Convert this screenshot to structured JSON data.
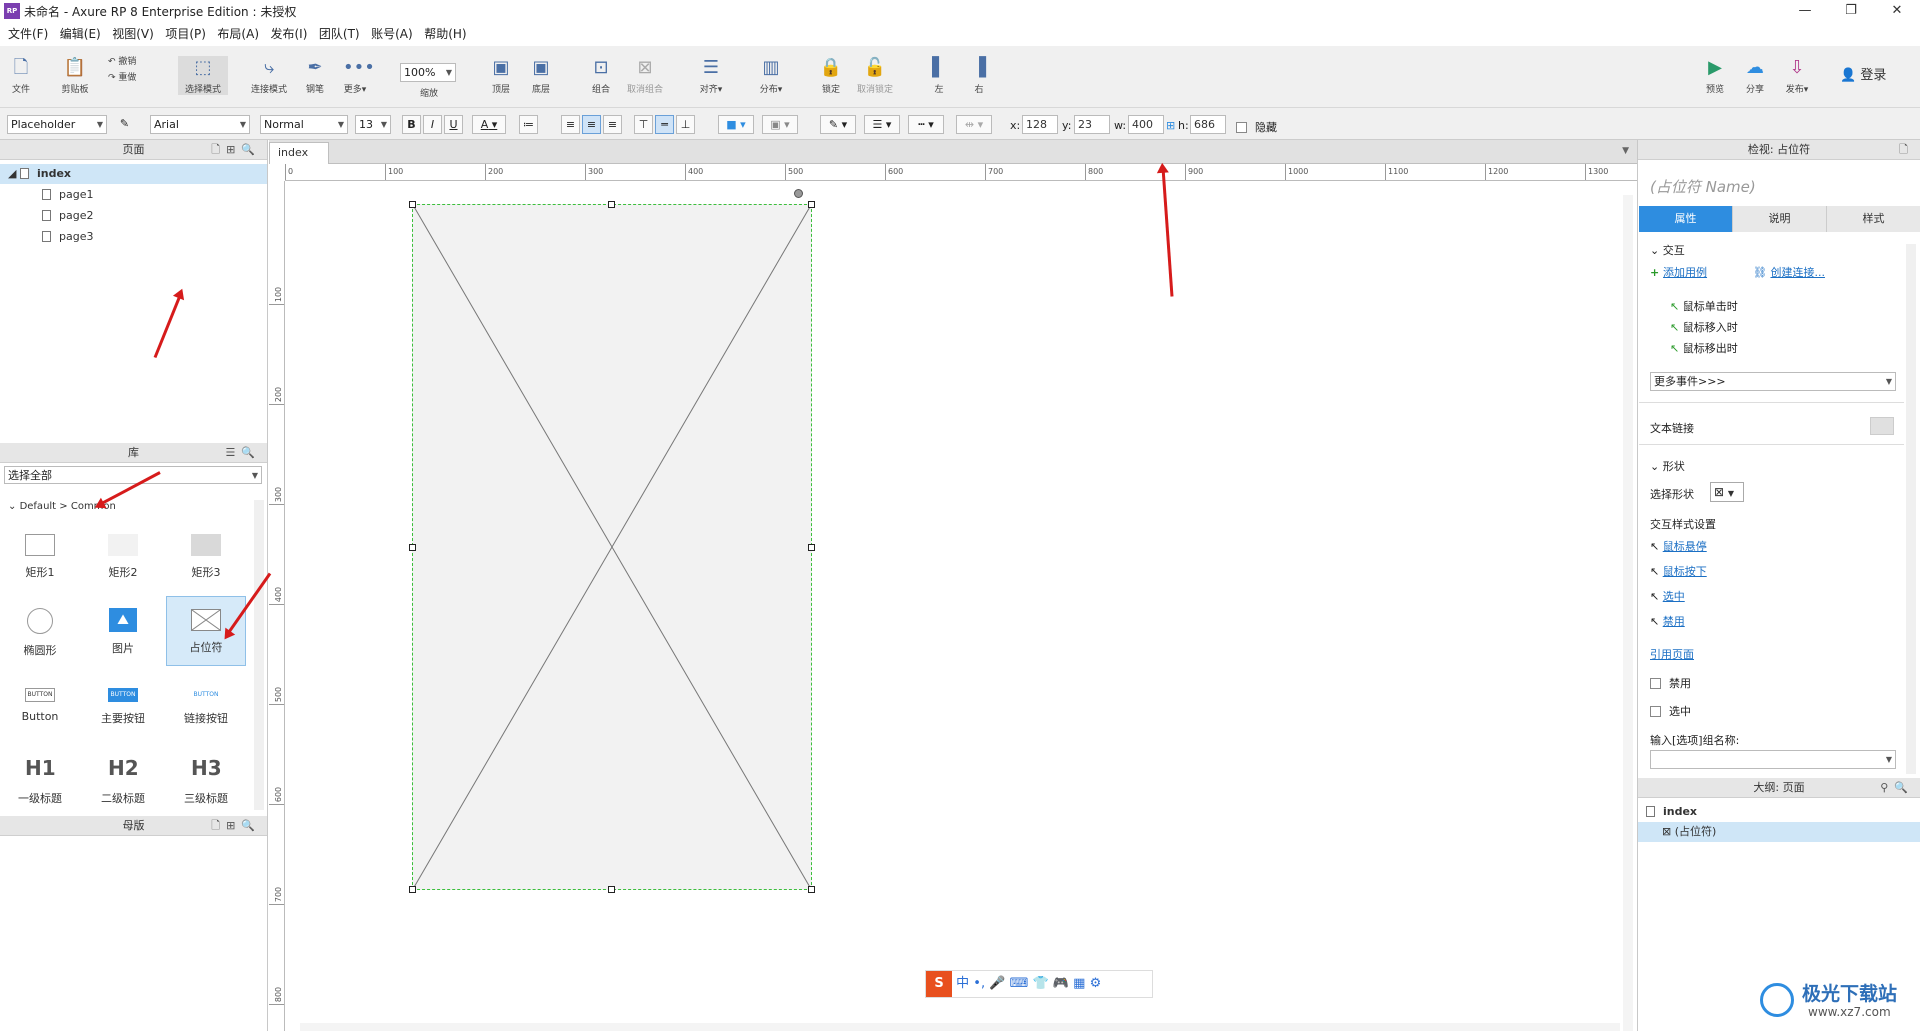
{
  "app": {
    "title": "未命名 - Axure RP 8 Enterprise Edition : 未授权",
    "logo_text": "RP",
    "login": "登录"
  },
  "menu": [
    "文件(F)",
    "编辑(E)",
    "视图(V)",
    "项目(P)",
    "布局(A)",
    "发布(I)",
    "团队(T)",
    "账号(A)",
    "帮助(H)"
  ],
  "toolbar": {
    "file": "文件",
    "clipboard": "剪贴板",
    "undo": "撤销",
    "redo": "重做",
    "select_mode": "选择模式",
    "connect_mode": "连接模式",
    "pen": "钢笔",
    "more": "更多▾",
    "zoom_value": "100%",
    "zoom_label": "缩放",
    "top": "顶层",
    "bottom": "底层",
    "group": "组合",
    "ungroup": "取消组合",
    "align": "对齐▾",
    "distribute": "分布▾",
    "lock": "锁定",
    "unlock": "取消锁定",
    "left": "左",
    "right": "右",
    "preview": "预览",
    "share": "分享",
    "publish": "发布▾"
  },
  "format": {
    "widget_type": "Placeholder",
    "font": "Arial",
    "style": "Normal",
    "size": "13",
    "bold": "B",
    "italic": "I",
    "underline": "U",
    "font_color": "A",
    "x_label": "x:",
    "x": "128",
    "y_label": "y:",
    "y": "23",
    "w_label": "w:",
    "w": "400",
    "h_label": "h:",
    "h": "686",
    "hidden": "隐藏"
  },
  "pages": {
    "title": "页面",
    "root": "index",
    "children": [
      "page1",
      "page2",
      "page3"
    ]
  },
  "library": {
    "title": "库",
    "filter": "选择全部",
    "group": "Default > Common",
    "widgets": [
      "矩形1",
      "矩形2",
      "矩形3",
      "椭圆形",
      "图片",
      "占位符",
      "Button",
      "主要按钮",
      "链接按钮",
      "一级标题",
      "二级标题",
      "三级标题"
    ],
    "button_text": "BUTTON",
    "h1": "H1",
    "h2": "H2",
    "h3": "H3"
  },
  "masters": {
    "title": "母版"
  },
  "canvas": {
    "tab": "index",
    "tab_close": "×",
    "ruler_h": [
      "0",
      "100",
      "200",
      "300",
      "400",
      "500",
      "600",
      "700",
      "800",
      "900",
      "1000",
      "1100",
      "1200",
      "1300"
    ],
    "ruler_v": [
      "100",
      "200",
      "300",
      "400",
      "500",
      "600",
      "700",
      "800"
    ]
  },
  "inspector": {
    "title": "检视: 占位符",
    "name_placeholder": "(占位符 Name)",
    "tabs": [
      "属性",
      "说明",
      "样式"
    ],
    "interaction": "交互",
    "add_case": "添加用例",
    "create_link": "创建连接...",
    "events": [
      "鼠标单击时",
      "鼠标移入时",
      "鼠标移出时"
    ],
    "more_events": "更多事件>>>",
    "text_link": "文本链接",
    "shape": "形状",
    "select_shape": "选择形状",
    "interaction_styles": "交互样式设置",
    "styles": [
      "鼠标悬停",
      "鼠标按下",
      "选中",
      "禁用"
    ],
    "ref_page": "引用页面",
    "disabled": "禁用",
    "selected": "选中",
    "group_name": "输入[选项]组名称:"
  },
  "outline": {
    "title": "大纲: 页面",
    "root": "index",
    "item": "(占位符)"
  },
  "ime": {
    "items": [
      "中",
      "•,",
      "🎤",
      "⌨",
      "👕",
      "🎮",
      "▦",
      "⚙"
    ]
  },
  "watermark": {
    "cn": "极光下载站",
    "url": "www.xz7.com"
  }
}
